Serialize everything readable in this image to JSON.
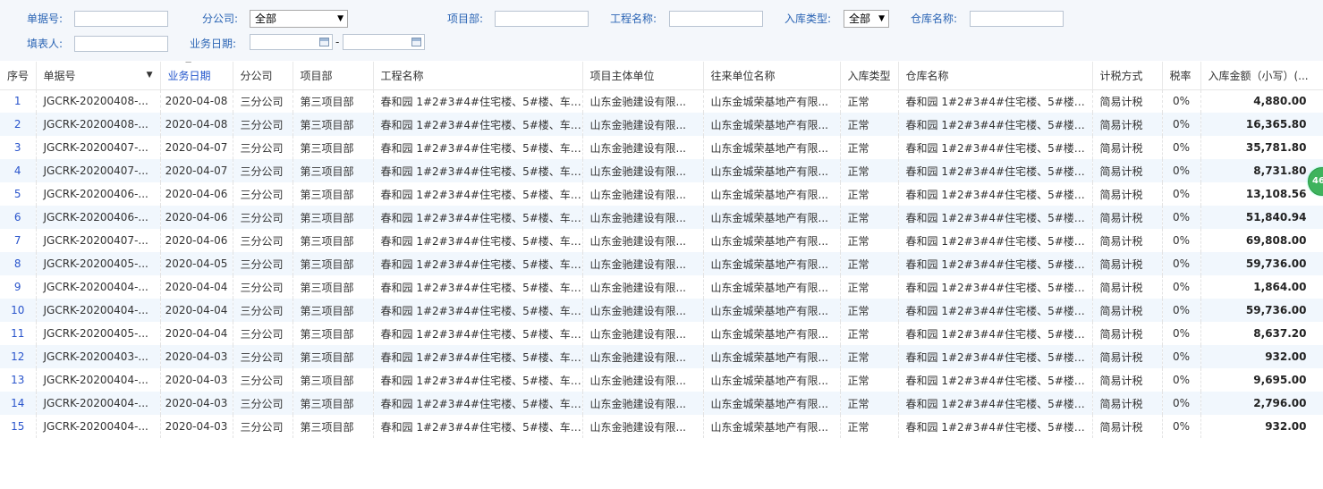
{
  "filters": {
    "doc_no_label": "单据号:",
    "branch_label": "分公司:",
    "branch_value": "全部",
    "project_dept_label": "项目部:",
    "project_name_label": "工程名称:",
    "type_label": "入库类型:",
    "type_value": "全部",
    "warehouse_label": "仓库名称:",
    "filler_label": "填表人:",
    "date_label": "业务日期:",
    "date_sep": "-"
  },
  "table": {
    "headers": {
      "seq": "序号",
      "doc_no": "单据号",
      "date": "业务日期",
      "branch": "分公司",
      "dept": "项目部",
      "project": "工程名称",
      "owner": "项目主体单位",
      "partner": "往来单位名称",
      "type": "入库类型",
      "warehouse": "仓库名称",
      "tax_method": "计税方式",
      "tax_rate": "税率",
      "amount": "入库金额（小写）(..."
    },
    "rows": [
      {
        "seq": "1",
        "doc_no": "JGCRK-20200408-...",
        "date": "2020-04-08",
        "branch": "三分公司",
        "dept": "第三项目部",
        "project": "春和园 1#2#3#4#住宅楼、5#楼、车库...",
        "owner": "山东金驰建设有限...",
        "partner": "山东金城荣基地产有限...",
        "type": "正常",
        "warehouse": "春和园 1#2#3#4#住宅楼、5#楼、...",
        "tax_method": "简易计税",
        "tax_rate": "0%",
        "amount": "4,880.00"
      },
      {
        "seq": "2",
        "doc_no": "JGCRK-20200408-...",
        "date": "2020-04-08",
        "branch": "三分公司",
        "dept": "第三项目部",
        "project": "春和园 1#2#3#4#住宅楼、5#楼、车库...",
        "owner": "山东金驰建设有限...",
        "partner": "山东金城荣基地产有限...",
        "type": "正常",
        "warehouse": "春和园 1#2#3#4#住宅楼、5#楼、...",
        "tax_method": "简易计税",
        "tax_rate": "0%",
        "amount": "16,365.80"
      },
      {
        "seq": "3",
        "doc_no": "JGCRK-20200407-...",
        "date": "2020-04-07",
        "branch": "三分公司",
        "dept": "第三项目部",
        "project": "春和园 1#2#3#4#住宅楼、5#楼、车库...",
        "owner": "山东金驰建设有限...",
        "partner": "山东金城荣基地产有限...",
        "type": "正常",
        "warehouse": "春和园 1#2#3#4#住宅楼、5#楼、...",
        "tax_method": "简易计税",
        "tax_rate": "0%",
        "amount": "35,781.80"
      },
      {
        "seq": "4",
        "doc_no": "JGCRK-20200407-...",
        "date": "2020-04-07",
        "branch": "三分公司",
        "dept": "第三项目部",
        "project": "春和园 1#2#3#4#住宅楼、5#楼、车库...",
        "owner": "山东金驰建设有限...",
        "partner": "山东金城荣基地产有限...",
        "type": "正常",
        "warehouse": "春和园 1#2#3#4#住宅楼、5#楼、...",
        "tax_method": "简易计税",
        "tax_rate": "0%",
        "amount": "8,731.80"
      },
      {
        "seq": "5",
        "doc_no": "JGCRK-20200406-...",
        "date": "2020-04-06",
        "branch": "三分公司",
        "dept": "第三项目部",
        "project": "春和园 1#2#3#4#住宅楼、5#楼、车库...",
        "owner": "山东金驰建设有限...",
        "partner": "山东金城荣基地产有限...",
        "type": "正常",
        "warehouse": "春和园 1#2#3#4#住宅楼、5#楼、...",
        "tax_method": "简易计税",
        "tax_rate": "0%",
        "amount": "13,108.56"
      },
      {
        "seq": "6",
        "doc_no": "JGCRK-20200406-...",
        "date": "2020-04-06",
        "branch": "三分公司",
        "dept": "第三项目部",
        "project": "春和园 1#2#3#4#住宅楼、5#楼、车库...",
        "owner": "山东金驰建设有限...",
        "partner": "山东金城荣基地产有限...",
        "type": "正常",
        "warehouse": "春和园 1#2#3#4#住宅楼、5#楼、...",
        "tax_method": "简易计税",
        "tax_rate": "0%",
        "amount": "51,840.94"
      },
      {
        "seq": "7",
        "doc_no": "JGCRK-20200407-...",
        "date": "2020-04-06",
        "branch": "三分公司",
        "dept": "第三项目部",
        "project": "春和园 1#2#3#4#住宅楼、5#楼、车库...",
        "owner": "山东金驰建设有限...",
        "partner": "山东金城荣基地产有限...",
        "type": "正常",
        "warehouse": "春和园 1#2#3#4#住宅楼、5#楼、...",
        "tax_method": "简易计税",
        "tax_rate": "0%",
        "amount": "69,808.00"
      },
      {
        "seq": "8",
        "doc_no": "JGCRK-20200405-...",
        "date": "2020-04-05",
        "branch": "三分公司",
        "dept": "第三项目部",
        "project": "春和园 1#2#3#4#住宅楼、5#楼、车库...",
        "owner": "山东金驰建设有限...",
        "partner": "山东金城荣基地产有限...",
        "type": "正常",
        "warehouse": "春和园 1#2#3#4#住宅楼、5#楼、...",
        "tax_method": "简易计税",
        "tax_rate": "0%",
        "amount": "59,736.00"
      },
      {
        "seq": "9",
        "doc_no": "JGCRK-20200404-...",
        "date": "2020-04-04",
        "branch": "三分公司",
        "dept": "第三项目部",
        "project": "春和园 1#2#3#4#住宅楼、5#楼、车库...",
        "owner": "山东金驰建设有限...",
        "partner": "山东金城荣基地产有限...",
        "type": "正常",
        "warehouse": "春和园 1#2#3#4#住宅楼、5#楼、...",
        "tax_method": "简易计税",
        "tax_rate": "0%",
        "amount": "1,864.00"
      },
      {
        "seq": "10",
        "doc_no": "JGCRK-20200404-...",
        "date": "2020-04-04",
        "branch": "三分公司",
        "dept": "第三项目部",
        "project": "春和园 1#2#3#4#住宅楼、5#楼、车库...",
        "owner": "山东金驰建设有限...",
        "partner": "山东金城荣基地产有限...",
        "type": "正常",
        "warehouse": "春和园 1#2#3#4#住宅楼、5#楼、...",
        "tax_method": "简易计税",
        "tax_rate": "0%",
        "amount": "59,736.00"
      },
      {
        "seq": "11",
        "doc_no": "JGCRK-20200405-...",
        "date": "2020-04-04",
        "branch": "三分公司",
        "dept": "第三项目部",
        "project": "春和园 1#2#3#4#住宅楼、5#楼、车库...",
        "owner": "山东金驰建设有限...",
        "partner": "山东金城荣基地产有限...",
        "type": "正常",
        "warehouse": "春和园 1#2#3#4#住宅楼、5#楼、...",
        "tax_method": "简易计税",
        "tax_rate": "0%",
        "amount": "8,637.20"
      },
      {
        "seq": "12",
        "doc_no": "JGCRK-20200403-...",
        "date": "2020-04-03",
        "branch": "三分公司",
        "dept": "第三项目部",
        "project": "春和园 1#2#3#4#住宅楼、5#楼、车库...",
        "owner": "山东金驰建设有限...",
        "partner": "山东金城荣基地产有限...",
        "type": "正常",
        "warehouse": "春和园 1#2#3#4#住宅楼、5#楼、...",
        "tax_method": "简易计税",
        "tax_rate": "0%",
        "amount": "932.00"
      },
      {
        "seq": "13",
        "doc_no": "JGCRK-20200404-...",
        "date": "2020-04-03",
        "branch": "三分公司",
        "dept": "第三项目部",
        "project": "春和园 1#2#3#4#住宅楼、5#楼、车库...",
        "owner": "山东金驰建设有限...",
        "partner": "山东金城荣基地产有限...",
        "type": "正常",
        "warehouse": "春和园 1#2#3#4#住宅楼、5#楼、...",
        "tax_method": "简易计税",
        "tax_rate": "0%",
        "amount": "9,695.00"
      },
      {
        "seq": "14",
        "doc_no": "JGCRK-20200404-...",
        "date": "2020-04-03",
        "branch": "三分公司",
        "dept": "第三项目部",
        "project": "春和园 1#2#3#4#住宅楼、5#楼、车库...",
        "owner": "山东金驰建设有限...",
        "partner": "山东金城荣基地产有限...",
        "type": "正常",
        "warehouse": "春和园 1#2#3#4#住宅楼、5#楼、...",
        "tax_method": "简易计税",
        "tax_rate": "0%",
        "amount": "2,796.00"
      },
      {
        "seq": "15",
        "doc_no": "JGCRK-20200404-...",
        "date": "2020-04-03",
        "branch": "三分公司",
        "dept": "第三项目部",
        "project": "春和园 1#2#3#4#住宅楼、5#楼、车库...",
        "owner": "山东金驰建设有限...",
        "partner": "山东金城荣基地产有限...",
        "type": "正常",
        "warehouse": "春和园 1#2#3#4#住宅楼、5#楼、...",
        "tax_method": "简易计税",
        "tax_rate": "0%",
        "amount": "932.00"
      }
    ]
  },
  "badge": {
    "text": "46"
  },
  "colors": {
    "label_blue": "#2a64b4",
    "row_alt": "#f1f7fd",
    "badge_green": "#3fb35d"
  }
}
